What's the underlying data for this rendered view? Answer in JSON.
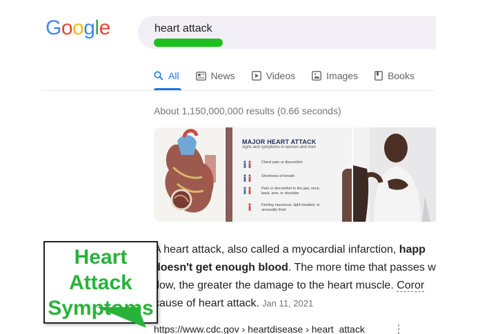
{
  "logo": {
    "letters": [
      "G",
      "o",
      "o",
      "g",
      "l",
      "e"
    ],
    "colors": [
      "#4285f4",
      "#ea4335",
      "#fbbc05",
      "#4285f4",
      "#34a853",
      "#ea4335"
    ]
  },
  "search": {
    "query": "heart attack",
    "highlight_color": "#1ec01e"
  },
  "tabs": [
    {
      "label": "All",
      "icon": "search-icon",
      "active": true
    },
    {
      "label": "News",
      "icon": "news-icon"
    },
    {
      "label": "Videos",
      "icon": "play-icon"
    },
    {
      "label": "Images",
      "icon": "image-icon"
    },
    {
      "label": "Books",
      "icon": "book-icon"
    }
  ],
  "result_stats": "About 1,150,000,000 results (0.66 seconds)",
  "images": {
    "infographic": {
      "title": "MAJOR HEART ATTACK",
      "subtitle": "signs and symptoms in women and men",
      "items": [
        "Chest pain or discomfort",
        "Shortness of breath",
        "Pain or discomfort in the jaw, neck, back, arm, or shoulder",
        "Feeling nauseous, light-headed, or unusually tired"
      ]
    }
  },
  "snippet": {
    "line1_a": "A heart attack, also called a myocardial infarction, ",
    "line1_b": "happ",
    "line2_a": "doesn't get enough blood",
    "line2_b": ". The more time that passes w",
    "line3_a": "flow, the greater the damage to the heart muscle. ",
    "line3_b": "Coror",
    "line4_a": "cause of heart attack.",
    "date": "Jan 11, 2021"
  },
  "result_url": "https://www.cdc.gov › heartdisease › heart_attack",
  "overlay": {
    "lines": [
      "Heart",
      "Attack",
      "Symptoms"
    ],
    "color": "#27b339"
  }
}
